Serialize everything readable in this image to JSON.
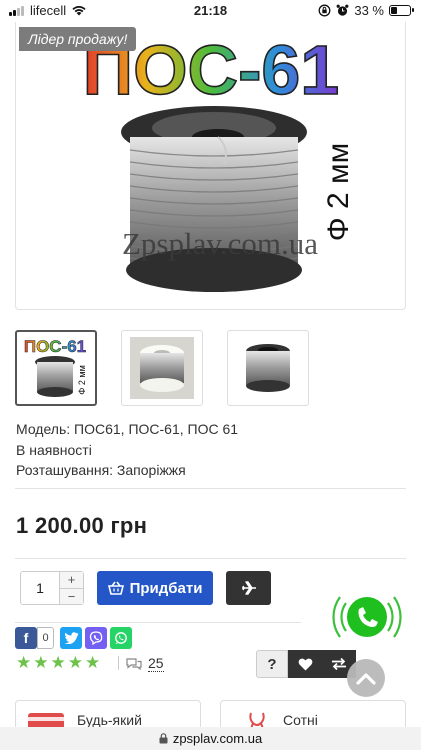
{
  "status_bar": {
    "carrier": "lifecell",
    "time": "21:18",
    "battery_text": "33 %",
    "battery_level": 0.33
  },
  "product": {
    "badge": "Лідер продажу!",
    "image_title": "ПОС-61",
    "image_side_text": "Φ 2 мм",
    "image_watermark": "Zpsplav.com.ua",
    "model": "Модель: ПОС61, ПОС-61, ПОС 61",
    "availability": "В наявності",
    "location": "Розташування: Запоріжжя",
    "price": "1 200.00 грн"
  },
  "thumbnails": [
    {
      "title": "ПОС-61",
      "side": "Φ 2 мм"
    },
    {
      "title": ""
    },
    {
      "title": ""
    }
  ],
  "purchase": {
    "quantity": "1",
    "qty_plus": "+",
    "qty_minus": "−",
    "buy_label": "Придбати"
  },
  "social": {
    "facebook_count": "0"
  },
  "rating": {
    "stars": 5,
    "reviews_count": "25"
  },
  "actions": {
    "question": "?"
  },
  "bottom_cards": [
    {
      "label": "Будь-який"
    },
    {
      "label": "Сотні"
    }
  ],
  "url_bar": {
    "domain": "zpsplav.com.ua"
  },
  "colors": {
    "buy_button": "#2456c8",
    "dark_button": "#333333",
    "stars": "#6cc24a",
    "call_widget": "#1fbf1f",
    "badge": "#7c7c7c"
  }
}
